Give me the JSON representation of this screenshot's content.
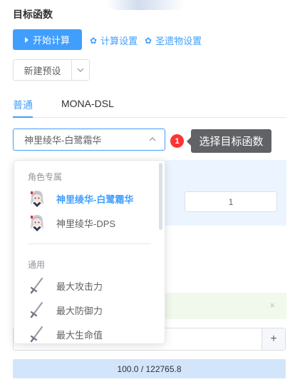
{
  "header": {
    "title": "目标函数"
  },
  "toolbar": {
    "start_label": "开始计算",
    "calc_settings_label": "计算设置",
    "artifact_settings_label": "圣遗物设置"
  },
  "preset": {
    "label": "新建预设"
  },
  "tabs": [
    {
      "label": "普通",
      "active": true
    },
    {
      "label": "MONA-DSL",
      "active": false
    }
  ],
  "function_select": {
    "value": "神里绫华-白鹭霜华"
  },
  "guide": {
    "step": "1",
    "tip": "选择目标函数"
  },
  "dropdown": {
    "groups": [
      {
        "title": "角色专属",
        "options": [
          {
            "label": "神里绫华-白鹭霜华",
            "icon": "ayaka-avatar-icon",
            "selected": true
          },
          {
            "label": "神里绫华-DPS",
            "icon": "ayaka-avatar-icon",
            "selected": false
          }
        ]
      },
      {
        "title": "通用",
        "options": [
          {
            "label": "最大攻击力",
            "icon": "sword-icon",
            "selected": false
          },
          {
            "label": "最大防御力",
            "icon": "sword-icon",
            "selected": false
          },
          {
            "label": "最大生命值",
            "icon": "sword-icon",
            "selected": false
          }
        ]
      }
    ]
  },
  "param_input": {
    "value": "1"
  },
  "alert": {
    "close": "×"
  },
  "stepper": {
    "plus": "+"
  },
  "progress": {
    "text": "100.0 / 122765.8"
  },
  "colors": {
    "accent": "#409eff",
    "badge": "#ff3333",
    "tooltip_bg": "#606266",
    "progress_bg": "#d3e5fb"
  }
}
